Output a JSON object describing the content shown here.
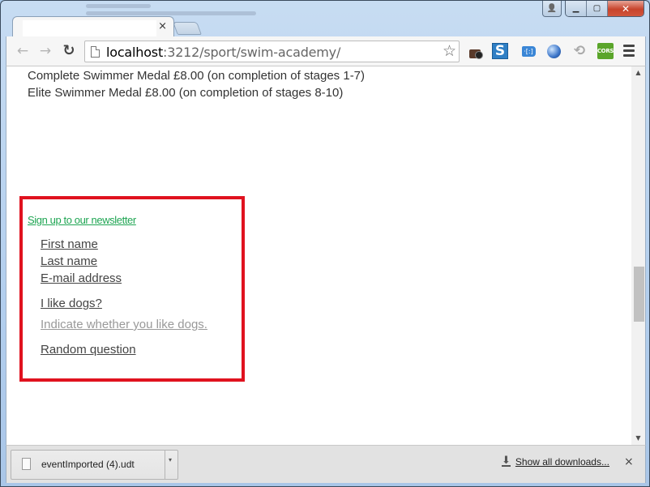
{
  "browser": {
    "tab": {
      "title": "",
      "close_icon": "×"
    },
    "window_controls": {
      "profile_icon": "👤",
      "minimize": "▁",
      "maximize": "▢",
      "close": "✕"
    },
    "toolbar": {
      "back_icon": "←",
      "forward_icon": "→",
      "reload_icon": "↻",
      "url_host": "localhost",
      "url_rest": ":3212/sport/swim-academy/",
      "bookmark_star_icon": "☆",
      "extensions": {
        "s_label": "S",
        "tag_label": "·[:]",
        "history_icon": "⟲",
        "cors_label": "CORS"
      }
    }
  },
  "page": {
    "medals": [
      "Complete Swimmer Medal £8.00 (on completion of stages 1-7)",
      "Elite Swimmer Medal £8.00 (on completion of stages 8-10)"
    ],
    "newsletter": {
      "link_text": "Sign up to our newsletter",
      "fields": {
        "first_name": "First name",
        "last_name": "Last name",
        "email": "E-mail address",
        "dogs": "I like dogs?",
        "dogs_hint": "Indicate whether you like dogs.",
        "random": "Random question"
      },
      "highlight_color": "#e0121f",
      "link_color": "#1ea552"
    },
    "scrollbar": {
      "up_icon": "▲",
      "down_icon": "▼"
    }
  },
  "download_shelf": {
    "item": {
      "file_name": "eventImported (4).udt",
      "menu_icon": "▾"
    },
    "download_icon": "⬇",
    "show_all_label": "Show all downloads...",
    "close_icon": "×"
  }
}
